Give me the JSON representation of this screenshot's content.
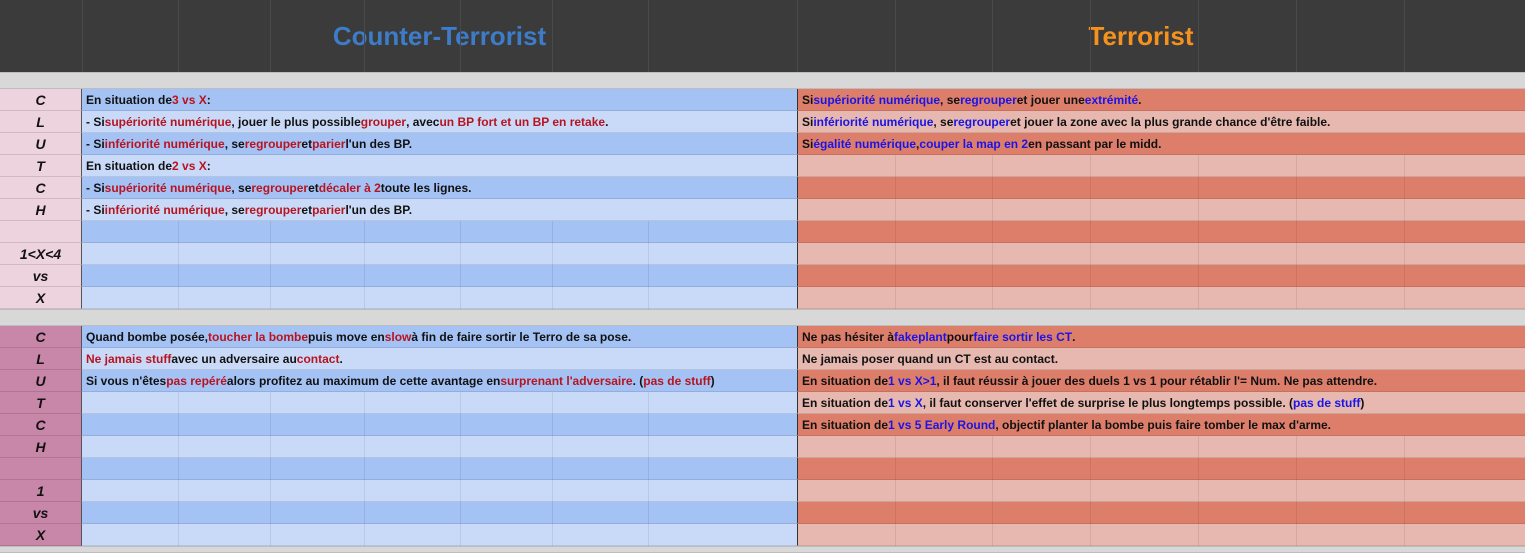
{
  "header": {
    "ct_title": "Counter-Terrorist",
    "t_title": "Terrorist",
    "ct_color": "#3d7cc8",
    "t_color": "#f5921e"
  },
  "section1": {
    "labels": [
      "C",
      "L",
      "U",
      "T",
      "C",
      "H",
      "",
      "1<X<4",
      "vs",
      "X"
    ],
    "ct_rows": [
      [
        {
          "t": "En situation de "
        },
        {
          "t": "3 vs X",
          "c": "red"
        },
        {
          "t": " :"
        }
      ],
      [
        {
          "t": "- Si "
        },
        {
          "t": "supériorité numérique",
          "c": "red"
        },
        {
          "t": ", jouer le plus possible "
        },
        {
          "t": "grouper",
          "c": "red"
        },
        {
          "t": ", avec "
        },
        {
          "t": "un BP fort et un BP en retake",
          "c": "red"
        },
        {
          "t": "."
        }
      ],
      [
        {
          "t": "- Si "
        },
        {
          "t": "infériorité numérique",
          "c": "red"
        },
        {
          "t": ", se "
        },
        {
          "t": "regrouper",
          "c": "red"
        },
        {
          "t": " et "
        },
        {
          "t": "parier",
          "c": "red"
        },
        {
          "t": " l'un des BP."
        }
      ],
      [
        {
          "t": "En situation de "
        },
        {
          "t": "2 vs X",
          "c": "red"
        },
        {
          "t": " :"
        }
      ],
      [
        {
          "t": "- Si "
        },
        {
          "t": "supériorité numérique",
          "c": "red"
        },
        {
          "t": ", se "
        },
        {
          "t": "regrouper",
          "c": "red"
        },
        {
          "t": " et "
        },
        {
          "t": "décaler à 2",
          "c": "red"
        },
        {
          "t": " toute les lignes."
        }
      ],
      [
        {
          "t": "- Si "
        },
        {
          "t": "infériorité numérique",
          "c": "red"
        },
        {
          "t": ", se "
        },
        {
          "t": "regrouper",
          "c": "red"
        },
        {
          "t": " et "
        },
        {
          "t": "parier",
          "c": "red"
        },
        {
          "t": " l'un des BP."
        }
      ],
      [],
      [],
      [],
      []
    ],
    "t_rows": [
      [
        {
          "t": "Si "
        },
        {
          "t": "supériorité numérique",
          "c": "blue"
        },
        {
          "t": ", se "
        },
        {
          "t": "regrouper",
          "c": "blue"
        },
        {
          "t": " et jouer une "
        },
        {
          "t": "extrémité",
          "c": "blue"
        },
        {
          "t": "."
        }
      ],
      [
        {
          "t": "Si "
        },
        {
          "t": "infériorité numérique",
          "c": "blue"
        },
        {
          "t": ", se "
        },
        {
          "t": "regrouper",
          "c": "blue"
        },
        {
          "t": " et jouer la zone avec la plus grande chance d'être faible."
        }
      ],
      [
        {
          "t": "Si "
        },
        {
          "t": "égalité numérique",
          "c": "blue"
        },
        {
          "t": ", "
        },
        {
          "t": "couper la map en 2",
          "c": "blue"
        },
        {
          "t": " en passant par le midd."
        }
      ],
      [],
      [],
      [],
      [],
      [],
      [],
      []
    ]
  },
  "section2": {
    "labels": [
      "C",
      "L",
      "U",
      "T",
      "C",
      "H",
      "",
      "1",
      "vs",
      "X"
    ],
    "ct_rows": [
      [
        {
          "t": "Quand bombe posée, "
        },
        {
          "t": "toucher la bombe",
          "c": "red"
        },
        {
          "t": " puis move en "
        },
        {
          "t": "slow",
          "c": "red"
        },
        {
          "t": " à fin de faire sortir le Terro de sa pose."
        }
      ],
      [
        {
          "t": "Ne jamais stuff",
          "c": "red"
        },
        {
          "t": " avec un adversaire au "
        },
        {
          "t": "contact",
          "c": "red"
        },
        {
          "t": "."
        }
      ],
      [
        {
          "t": "Si vous n'êtes "
        },
        {
          "t": "pas repéré",
          "c": "red"
        },
        {
          "t": " alors profitez au maximum de cette avantage en "
        },
        {
          "t": "surprenant l'adversaire",
          "c": "red"
        },
        {
          "t": ". ("
        },
        {
          "t": "pas de stuff",
          "c": "red"
        },
        {
          "t": ")"
        }
      ],
      [],
      [],
      [],
      [],
      [],
      [],
      []
    ],
    "t_rows": [
      [
        {
          "t": "Ne pas hésiter à "
        },
        {
          "t": "fakeplant",
          "c": "blue"
        },
        {
          "t": " pour "
        },
        {
          "t": "faire sortir les CT",
          "c": "blue"
        },
        {
          "t": "."
        }
      ],
      [
        {
          "t": "Ne jamais poser quand un CT est au contact."
        }
      ],
      [
        {
          "t": "En situation de "
        },
        {
          "t": "1 vs X>1",
          "c": "blue"
        },
        {
          "t": ", il faut réussir à jouer des duels 1 vs 1 pour rétablir l'= Num. Ne pas attendre."
        }
      ],
      [
        {
          "t": "En situation de "
        },
        {
          "t": "1 vs X",
          "c": "blue"
        },
        {
          "t": ", il faut conserver l'effet de surprise le plus longtemps possible. ("
        },
        {
          "t": "pas de stuff",
          "c": "blue"
        },
        {
          "t": ")"
        }
      ],
      [
        {
          "t": "En situation de "
        },
        {
          "t": "1 vs 5 Early Round",
          "c": "blue"
        },
        {
          "t": ", objectif planter la bombe puis faire tomber le max d'arme."
        }
      ],
      [],
      [],
      [],
      [],
      []
    ]
  },
  "colors": {
    "header_bg": "#3b3b3b",
    "separator": "#d8d8d8",
    "label1": "#ecd3dd",
    "label2": "#c886a8",
    "ct_dark": "#a4c2f4",
    "ct_light": "#c9daf8",
    "t_dark": "#dd7e6b",
    "t_light": "#e6b8af"
  }
}
